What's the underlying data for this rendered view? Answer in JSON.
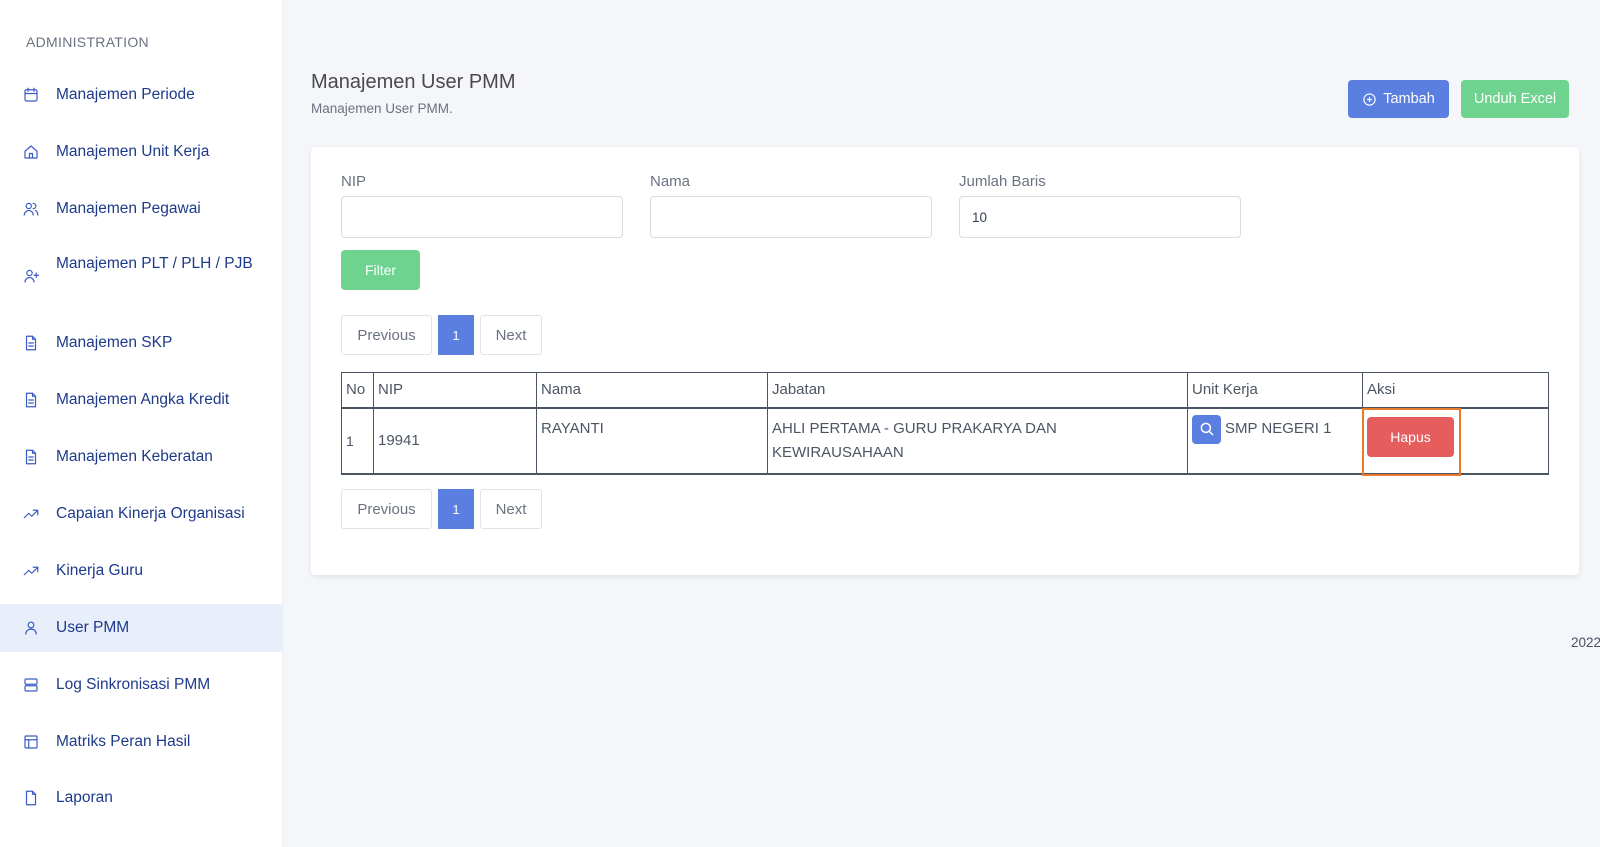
{
  "sidebar": {
    "heading": "ADMINISTRATION",
    "items": [
      {
        "label": "Manajemen Periode",
        "icon": "calendar-icon"
      },
      {
        "label": "Manajemen Unit Kerja",
        "icon": "home-icon"
      },
      {
        "label": "Manajemen Pegawai",
        "icon": "users-icon"
      },
      {
        "label": "Manajemen PLT / PLH / PJB",
        "icon": "user-plus-icon"
      },
      {
        "label": "Manajemen SKP",
        "icon": "document-icon"
      },
      {
        "label": "Manajemen Angka Kredit",
        "icon": "document-icon"
      },
      {
        "label": "Manajemen Keberatan",
        "icon": "document-icon"
      },
      {
        "label": "Capaian Kinerja Organisasi",
        "icon": "trending-up-icon"
      },
      {
        "label": "Kinerja Guru",
        "icon": "trending-up-icon"
      },
      {
        "label": "User PMM",
        "icon": "user-icon"
      },
      {
        "label": "Log Sinkronisasi PMM",
        "icon": "server-icon"
      },
      {
        "label": "Matriks Peran Hasil",
        "icon": "layout-icon"
      },
      {
        "label": "Laporan",
        "icon": "file-icon"
      }
    ],
    "active_index": 9
  },
  "header": {
    "title": "Manajemen User PMM",
    "subtitle": "Manajemen User PMM.",
    "add_label": "Tambah",
    "excel_label": "Unduh Excel"
  },
  "filters": {
    "nip_label": "NIP",
    "nip_value": "",
    "nama_label": "Nama",
    "nama_value": "",
    "rows_label": "Jumlah Baris",
    "rows_value": "10",
    "filter_label": "Filter"
  },
  "pagination": {
    "previous": "Previous",
    "current": "1",
    "next": "Next"
  },
  "table": {
    "headers": [
      "No",
      "NIP",
      "Nama",
      "Jabatan",
      "Unit Kerja",
      "Aksi"
    ],
    "rows": [
      {
        "no": "1",
        "nip": "19941",
        "nama": "RAYANTI",
        "jabatan": "AHLI PERTAMA - GURU PRAKARYA DAN KEWIRAUSAHAAN",
        "unit_kerja": "SMP NEGERI 1",
        "action": "Hapus"
      }
    ]
  },
  "footer": {
    "year": "2022"
  },
  "colors": {
    "primary": "#5b7fe0",
    "success": "#6ed38f",
    "danger": "#e55d5d",
    "highlight": "#e97a2c",
    "nav_text": "#1e3a8a"
  }
}
